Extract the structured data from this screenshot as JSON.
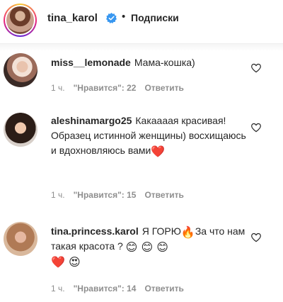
{
  "header": {
    "username": "tina_karol",
    "separator": "•",
    "follow_label": "Подписки"
  },
  "comments": [
    {
      "author": "miss__lemonade",
      "text": "Мама-кошка)",
      "time": "1 ч.",
      "likes": "\"Нравится\": 22",
      "reply": "Ответить"
    },
    {
      "author": "aleshinamargo25",
      "text": "Какаааая красивая! Образец истинной женщины) восхищаюсь и вдохновляюсь вами",
      "emoji": "❤️",
      "time": "1 ч.",
      "likes": "\"Нравится\": 15",
      "reply": "Ответить"
    },
    {
      "author": "tina.princess.karol",
      "text_before": "Я ГОРЮ",
      "emoji_fire": "🔥",
      "text_after": "За что нам такая красота ?",
      "emoji_smiles": "😊 😊 😊",
      "emoji_end": "❤️ 😍",
      "time": "1 ч.",
      "likes": "\"Нравится\": 14",
      "reply": "Ответить"
    }
  ],
  "colors": {
    "text": "#262626",
    "secondary": "#8e8e8e",
    "verified": "#3897f0",
    "heart": "#ed4956"
  },
  "icons": [
    "verified-badge-icon",
    "heart-outline-icon"
  ]
}
